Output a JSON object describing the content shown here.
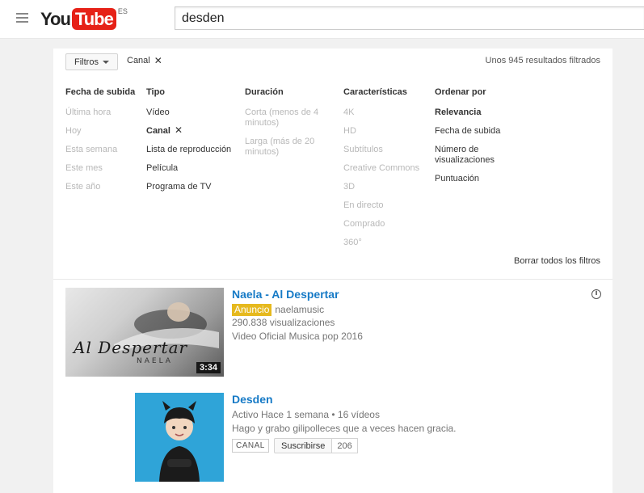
{
  "header": {
    "logo_you": "You",
    "logo_tube": "Tube",
    "region": "ES",
    "search_value": "desden"
  },
  "filter_bar": {
    "filters_label": "Filtros",
    "active_filter": "Canal",
    "result_count": "Unos 945 resultados filtrados"
  },
  "filter_columns": [
    {
      "title": "Fecha de subida",
      "options": [
        {
          "label": "Última hora",
          "state": "disabled"
        },
        {
          "label": "Hoy",
          "state": "disabled"
        },
        {
          "label": "Esta semana",
          "state": "disabled"
        },
        {
          "label": "Este mes",
          "state": "disabled"
        },
        {
          "label": "Este año",
          "state": "disabled"
        }
      ]
    },
    {
      "title": "Tipo",
      "options": [
        {
          "label": "Vídeo",
          "state": "normal"
        },
        {
          "label": "Canal",
          "state": "selected"
        },
        {
          "label": "Lista de reproducción",
          "state": "normal"
        },
        {
          "label": "Película",
          "state": "normal"
        },
        {
          "label": "Programa de TV",
          "state": "normal"
        }
      ]
    },
    {
      "title": "Duración",
      "options": [
        {
          "label": "Corta (menos de 4 minutos)",
          "state": "disabled"
        },
        {
          "label": "Larga (más de 20 minutos)",
          "state": "disabled"
        }
      ]
    },
    {
      "title": "Características",
      "options": [
        {
          "label": "4K",
          "state": "disabled"
        },
        {
          "label": "HD",
          "state": "disabled"
        },
        {
          "label": "Subtítulos",
          "state": "disabled"
        },
        {
          "label": "Creative Commons",
          "state": "disabled"
        },
        {
          "label": "3D",
          "state": "disabled"
        },
        {
          "label": "En directo",
          "state": "disabled"
        },
        {
          "label": "Comprado",
          "state": "disabled"
        },
        {
          "label": "360°",
          "state": "disabled"
        }
      ]
    },
    {
      "title": "Ordenar por",
      "options": [
        {
          "label": "Relevancia",
          "state": "active"
        },
        {
          "label": "Fecha de subida",
          "state": "normal"
        },
        {
          "label": "Número de visualizaciones",
          "state": "normal"
        },
        {
          "label": "Puntuación",
          "state": "normal"
        }
      ]
    }
  ],
  "clear_all": "Borrar todos los filtros",
  "results": {
    "ad": {
      "title": "Naela - Al Despertar",
      "badge": "Anuncio",
      "channel": "naelamusic",
      "views": "290.838 visualizaciones",
      "description": "Video Oficial Musica pop 2016",
      "duration": "3:34",
      "thumb_text": "Al Despertar",
      "thumb_name": "NAELA"
    },
    "channel": {
      "title": "Desden",
      "meta": "Activo Hace 1 semana • 16 vídeos",
      "description": "Hago y grabo gilipolleces que a veces hacen gracia.",
      "tag": "CANAL",
      "subscribe_label": "Suscribirse",
      "subscriber_count": "206"
    }
  },
  "colors": {
    "link_blue": "#167ac6",
    "ad_yellow": "#e6b91e",
    "youtube_red": "#e62117",
    "channel_bg": "#2fa4d8"
  }
}
